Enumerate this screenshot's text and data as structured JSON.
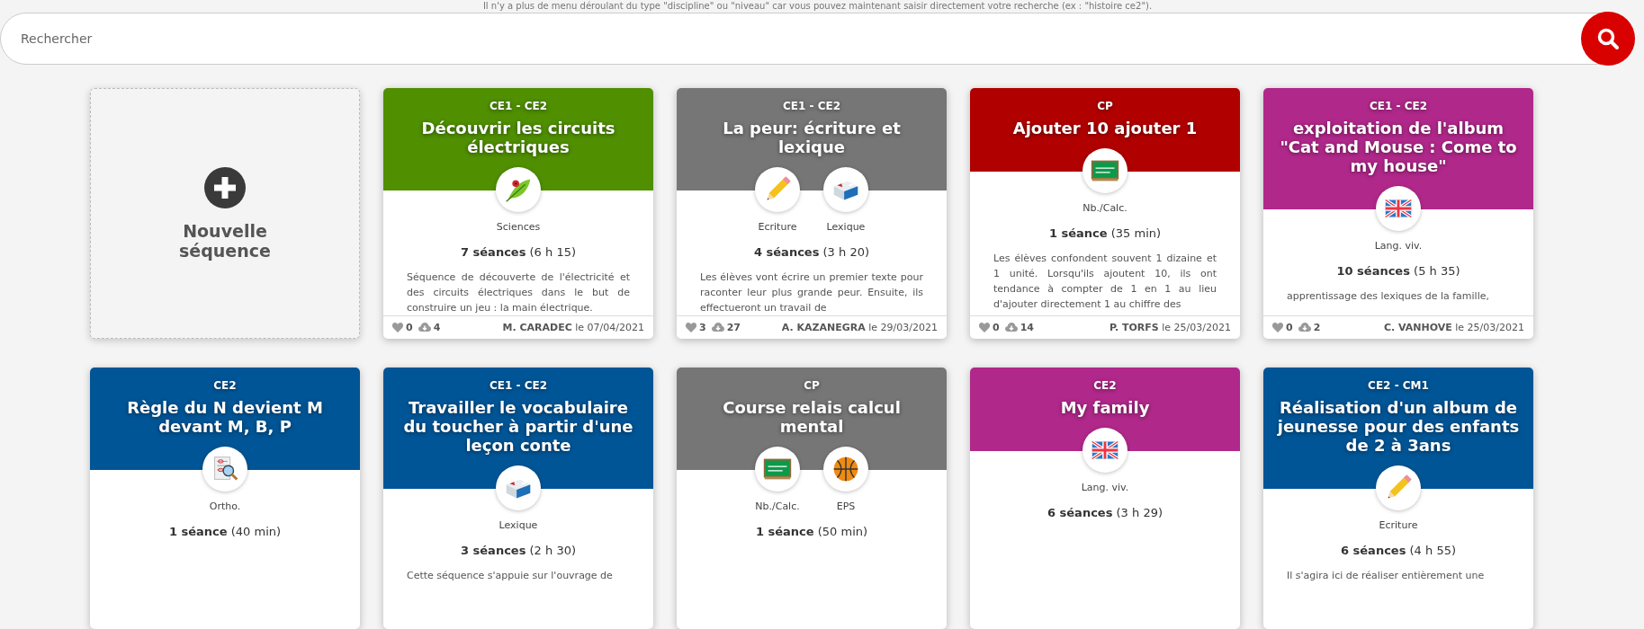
{
  "hint": "Il n'y a plus de menu déroulant du type \"discipline\" ou \"niveau\" car vous pouvez maintenant saisir directement votre recherche (ex : \"histoire ce2\").",
  "search": {
    "placeholder": "Rechercher"
  },
  "new_sequence": {
    "label": "Nouvelle séquence"
  },
  "sequences": [
    {
      "level": "CE1 - CE2",
      "title": "Découvrir les circuits électriques",
      "color": "#4f8f00",
      "subjects": [
        {
          "kind": "leaf",
          "label": "Sciences"
        }
      ],
      "sessions": "**7 séances** (6 h 15)",
      "description": "Séquence de découverte de l'électricité et des circuits électriques dans le but de construire un jeu : la main électrique.",
      "likes": "0",
      "downloads": "4",
      "author": "**M. CARADEC** le 07/04/2021"
    },
    {
      "level": "CE1 - CE2",
      "title": "La peur: écriture et lexique",
      "color": "#767676",
      "subjects": [
        {
          "kind": "pencil",
          "label": "Ecriture"
        },
        {
          "kind": "dictionary",
          "label": "Lexique"
        }
      ],
      "sessions": "**4 séances** (3 h 20)",
      "description": "Les élèves vont écrire un premier texte pour raconter leur plus grande peur. Ensuite, ils effectueront un travail de",
      "likes": "3",
      "downloads": "27",
      "author": "**A. KAZANEGRA** le 29/03/2021"
    },
    {
      "level": "CP",
      "title": "Ajouter 10 ajouter 1",
      "color": "#b00000",
      "subjects": [
        {
          "kind": "chalkboard",
          "label": "Nb./Calc."
        }
      ],
      "sessions": "**1 séance** (35 min)",
      "description": "Les élèves confondent souvent 1 dizaine et 1 unité. Lorsqu'ils ajoutent 10, ils ont tendance à compter de 1 en 1 au lieu d'ajouter directement 1 au chiffre des",
      "likes": "0",
      "downloads": "14",
      "author": "**P. TORFS** le 25/03/2021"
    },
    {
      "level": "CE1 - CE2",
      "title": "exploitation de l'album \"Cat and Mouse : Come to my house\"",
      "color": "#b0288a",
      "subjects": [
        {
          "kind": "flag",
          "label": "Lang. viv."
        }
      ],
      "sessions": "**10 séances** (5 h 35)",
      "description": "apprentissage des lexiques de la famille,",
      "likes": "0",
      "downloads": "2",
      "author": "**C. VANHOVE** le 25/03/2021"
    },
    {
      "level": "CE2",
      "title": "Règle du N devient M devant M, B, P",
      "color": "#005596",
      "subjects": [
        {
          "kind": "magnifier",
          "label": "Ortho."
        }
      ],
      "sessions": "**1 séance** (40 min)"
    },
    {
      "level": "CE1 - CE2",
      "title": "Travailler le vocabulaire du toucher à partir d'une leçon conte",
      "color": "#005596",
      "subjects": [
        {
          "kind": "dictionary",
          "label": "Lexique"
        }
      ],
      "sessions": "**3 séances** (2 h 30)",
      "description": "Cette séquence s'appuie sur l'ouvrage de"
    },
    {
      "level": "CP",
      "title": "Course relais calcul mental",
      "color": "#767676",
      "subjects": [
        {
          "kind": "chalkboard",
          "label": "Nb./Calc."
        },
        {
          "kind": "ball",
          "label": "EPS"
        }
      ],
      "sessions": "**1 séance** (50 min)"
    },
    {
      "level": "CE2",
      "title": "My family",
      "color": "#b0288a",
      "subjects": [
        {
          "kind": "flag",
          "label": "Lang. viv."
        }
      ],
      "sessions": "**6 séances** (3 h 29)"
    },
    {
      "level": "CE2 - CM1",
      "title": "Réalisation d'un album de jeunesse pour des enfants de 2 à 3ans",
      "color": "#005596",
      "subjects": [
        {
          "kind": "pencil",
          "label": "Ecriture"
        }
      ],
      "sessions": "**6 séances** (4 h 55)",
      "description": "Il s'agira ici de réaliser entièrement une"
    }
  ]
}
